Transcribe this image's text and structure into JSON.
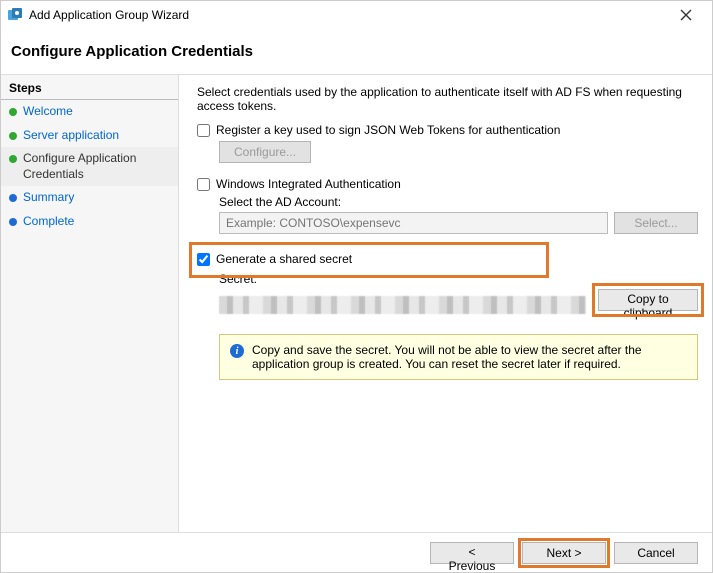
{
  "window": {
    "title": "Add Application Group Wizard"
  },
  "page": {
    "heading": "Configure Application Credentials"
  },
  "steps": {
    "header": "Steps",
    "items": [
      {
        "label": "Welcome",
        "state": "done"
      },
      {
        "label": "Server application",
        "state": "done"
      },
      {
        "label": "Configure Application Credentials",
        "state": "current"
      },
      {
        "label": "Summary",
        "state": "todo"
      },
      {
        "label": "Complete",
        "state": "todo"
      }
    ]
  },
  "content": {
    "instruction": "Select credentials used by the application to authenticate itself with AD FS when requesting access tokens.",
    "jwt": {
      "checkbox_label": "Register a key used to sign JSON Web Tokens for authentication",
      "checked": false,
      "configure_button": "Configure..."
    },
    "wia": {
      "checkbox_label": "Windows Integrated Authentication",
      "checked": false,
      "account_label": "Select the AD Account:",
      "account_placeholder": "Example: CONTOSO\\expensevc",
      "select_button": "Select..."
    },
    "secret": {
      "checkbox_label": "Generate a shared secret",
      "checked": true,
      "field_label": "Secret:",
      "copy_button": "Copy to clipboard",
      "info_text": "Copy and save the secret.  You will not be able to view the secret after the application group is created.  You can reset the secret later if required."
    }
  },
  "footer": {
    "previous": "< Previous",
    "next": "Next >",
    "cancel": "Cancel"
  }
}
